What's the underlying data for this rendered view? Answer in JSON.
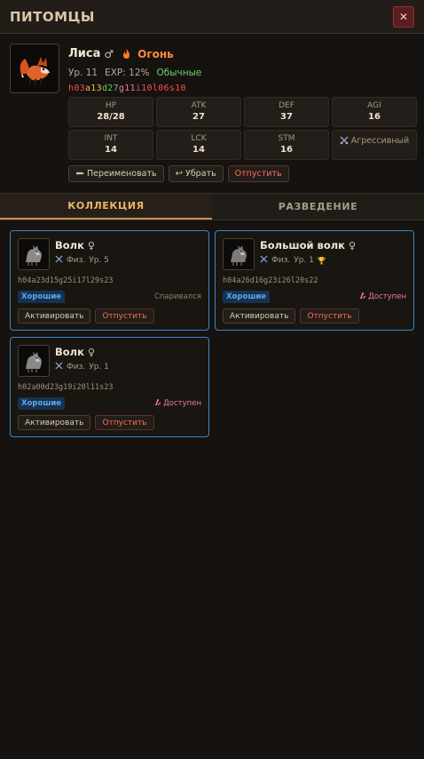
{
  "window": {
    "title": "ПИТОМЦЫ",
    "close": "✕"
  },
  "pet": {
    "name": "Лиса",
    "gender": "♂",
    "element": "Огонь",
    "level": "Ур. 11",
    "exp": "EXP: 12%",
    "rarity": "Обычные",
    "genes": [
      {
        "t": "h03",
        "c": "red"
      },
      {
        "t": "a13",
        "c": "yel"
      },
      {
        "t": "d27",
        "c": "grn"
      },
      {
        "t": "g11",
        "c": "pink"
      },
      {
        "t": "i10",
        "c": "red"
      },
      {
        "t": "l06",
        "c": "red"
      },
      {
        "t": "s10",
        "c": "red"
      }
    ],
    "stats": {
      "hp": {
        "label": "HP",
        "value": "28/28"
      },
      "atk": {
        "label": "ATK",
        "value": "27"
      },
      "def": {
        "label": "DEF",
        "value": "37"
      },
      "agi": {
        "label": "AGI",
        "value": "16"
      },
      "int": {
        "label": "INT",
        "value": "14"
      },
      "lck": {
        "label": "LCK",
        "value": "14"
      },
      "stm": {
        "label": "STM",
        "value": "16"
      },
      "behavior": "Агрессивный"
    },
    "actions": {
      "rename": "Переименовать",
      "unequip": "Убрать",
      "release": "Отпустить"
    }
  },
  "tabs": {
    "collection": "КОЛЛЕКЦИЯ",
    "breeding": "РАЗВЕДЕНИЕ"
  },
  "collection": [
    {
      "name": "Волк",
      "gender": "♀",
      "type": "Физ.",
      "level": "Ур. 5",
      "trophy": "",
      "gene": "h04a23d15g25i17l29s23",
      "rarity": "Хорошие",
      "status": "Спаривался",
      "status_type": "muted",
      "activate": "Активировать",
      "release": "Отпустить"
    },
    {
      "name": "Большой волк",
      "gender": "♀",
      "type": "Физ.",
      "level": "Ур. 1",
      "trophy": "🏆",
      "gene": "h04a26d16g23i26l20s22",
      "rarity": "Хорошие",
      "status": "Доступен",
      "status_type": "avail",
      "activate": "Активировать",
      "release": "Отпустить"
    },
    {
      "name": "Волк",
      "gender": "♀",
      "type": "Физ.",
      "level": "Ур. 1",
      "trophy": "",
      "gene": "h02a00d23g19i20l11s23",
      "rarity": "Хорошие",
      "status": "Доступен",
      "status_type": "avail",
      "activate": "Активировать",
      "release": "Отпустить"
    }
  ]
}
